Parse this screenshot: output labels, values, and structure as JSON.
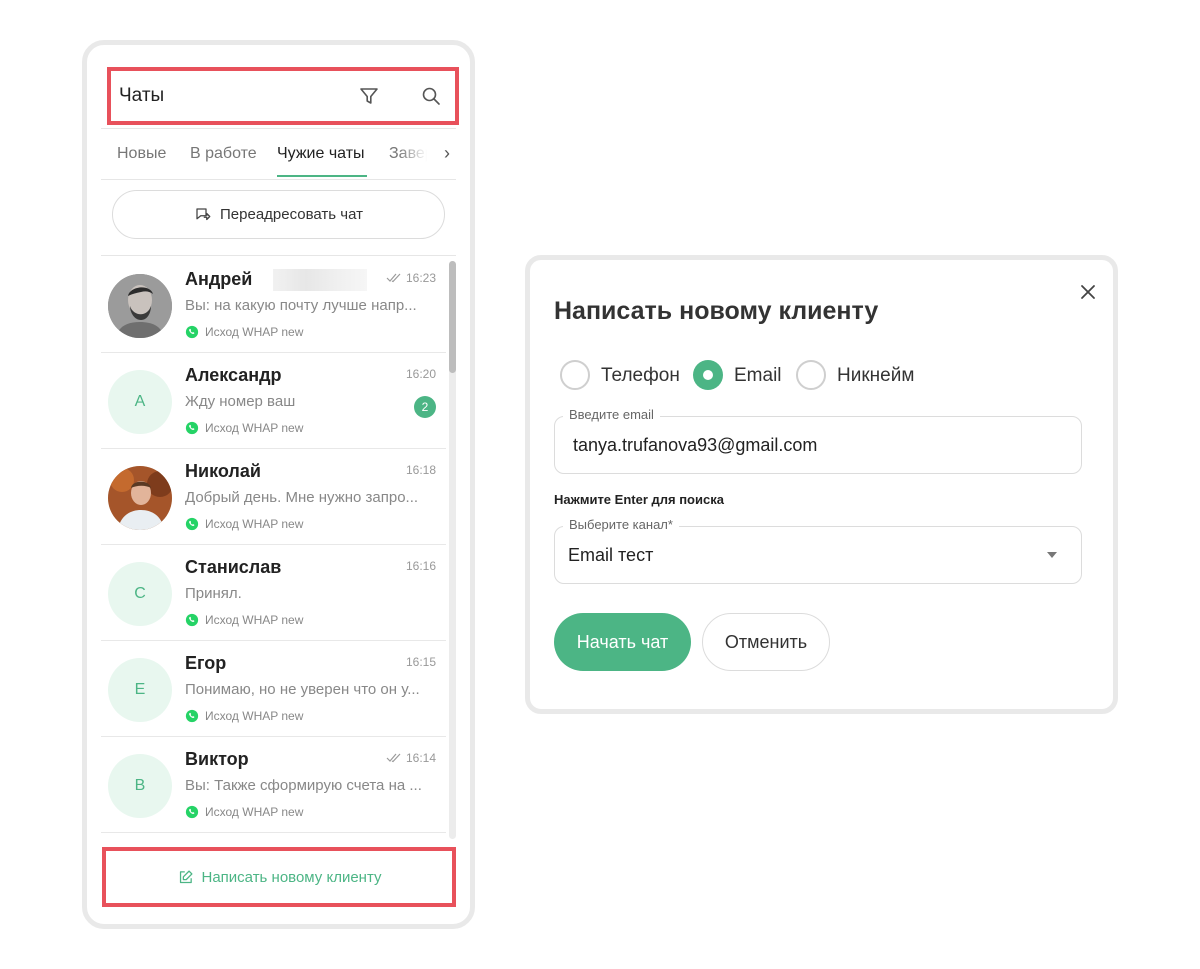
{
  "colors": {
    "accent": "#4cb585",
    "highlight": "#e8515b",
    "whatsapp": "#25d366"
  },
  "header": {
    "title": "Чаты",
    "icons": [
      "filter-icon",
      "search-icon"
    ]
  },
  "tabs": [
    {
      "label": "Новые",
      "active": false
    },
    {
      "label": "В работе",
      "active": false
    },
    {
      "label": "Чужие чаты",
      "active": true
    },
    {
      "label": "Завер",
      "active": false
    }
  ],
  "forward_button": {
    "label": "Переадресовать чат",
    "icon": "forward-chat-icon"
  },
  "chats": [
    {
      "name": "Андрей",
      "time": "16:23",
      "read": true,
      "message": "Вы: на какую почту лучше напр...",
      "channel": "Исход WHAP new",
      "avatar_letter": "",
      "photo": true,
      "unread": ""
    },
    {
      "name": "Александр",
      "time": "16:20",
      "read": false,
      "message": "Жду номер ваш",
      "channel": "Исход WHAP new",
      "avatar_letter": "А",
      "photo": false,
      "unread": "2"
    },
    {
      "name": "Николай",
      "time": "16:18",
      "read": false,
      "message": "Добрый день. Мне нужно запро...",
      "channel": "Исход WHAP new",
      "avatar_letter": "",
      "photo": true,
      "unread": ""
    },
    {
      "name": "Станислав",
      "time": "16:16",
      "read": false,
      "message": "Принял.",
      "channel": "Исход WHAP new",
      "avatar_letter": "С",
      "photo": false,
      "unread": ""
    },
    {
      "name": "Егор",
      "time": "16:15",
      "read": false,
      "message": "Понимаю, но не уверен что он у...",
      "channel": "Исход WHAP new",
      "avatar_letter": "Е",
      "photo": false,
      "unread": ""
    },
    {
      "name": "Виктор",
      "time": "16:14",
      "read": true,
      "message": "Вы: Также сформирую счета на ...",
      "channel": "Исход WHAP new",
      "avatar_letter": "В",
      "photo": false,
      "unread": ""
    }
  ],
  "new_client_link": {
    "label": "Написать новому клиенту",
    "icon": "edit-icon"
  },
  "dialog": {
    "title": "Написать новому клиенту",
    "radio_options": [
      {
        "label": "Телефон",
        "checked": false
      },
      {
        "label": "Email",
        "checked": true
      },
      {
        "label": "Никнейм",
        "checked": false
      }
    ],
    "email_field": {
      "legend": "Введите email",
      "value": "tanya.trufanova93@gmail.com"
    },
    "hint": "Нажмите Enter для поиска",
    "channel_select": {
      "legend": "Выберите канал*",
      "value": "Email тест"
    },
    "start_button": "Начать чат",
    "cancel_button": "Отменить"
  }
}
